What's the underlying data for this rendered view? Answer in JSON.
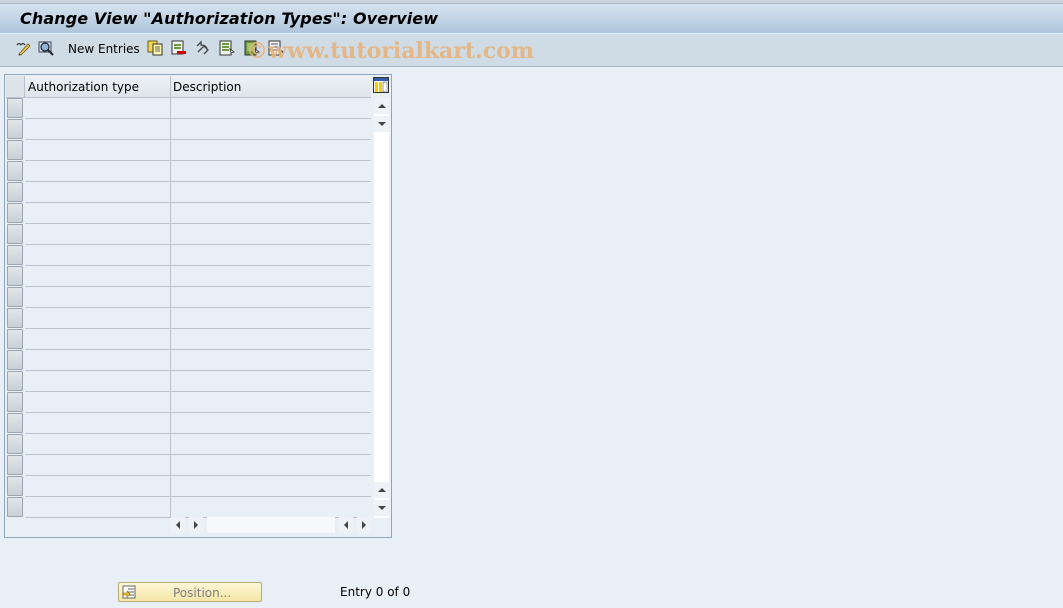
{
  "window": {
    "title": "Change View \"Authorization Types\": Overview"
  },
  "toolbar": {
    "items": [
      {
        "icon": "display-change-icon",
        "tooltip": "Display/Change"
      },
      {
        "icon": "find-icon",
        "tooltip": "Find"
      },
      {
        "label": "New Entries"
      },
      {
        "icon": "copy-as-icon"
      },
      {
        "icon": "delete-icon"
      },
      {
        "icon": "undo-change-icon"
      },
      {
        "icon": "select-all-icon"
      },
      {
        "icon": "select-block-icon"
      },
      {
        "icon": "deselect-all-icon"
      }
    ],
    "new_entries_label": "New Entries"
  },
  "watermark": "©www.tutorialkart.com",
  "table": {
    "columns": [
      "Authorization type",
      "Description"
    ],
    "row_count_visible": 20,
    "rows": []
  },
  "footer": {
    "position_button_label": "Position...",
    "entry_status": "Entry 0 of 0"
  }
}
